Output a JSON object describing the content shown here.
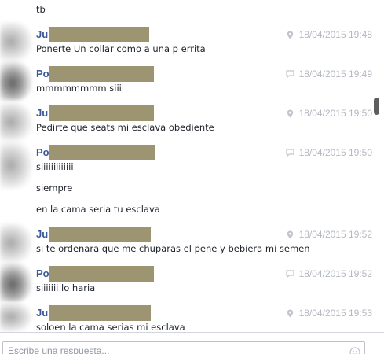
{
  "colors": {
    "sender": "#3b5998",
    "timestamp": "#b4b8c0",
    "text": "#1d2129",
    "redaction": "#9d9472"
  },
  "messages": [
    {
      "lines": [
        "tb"
      ]
    },
    {
      "sender": "Ju",
      "icon": "location-pin-icon",
      "timestamp": "18/04/2015 19:48",
      "lines": [
        "Ponerte Un collar como a una p errita"
      ]
    },
    {
      "sender": "Po",
      "icon": "chat-bubble-icon",
      "timestamp": "18/04/2015 19:49",
      "lines": [
        "mmmmmmmm siiii"
      ]
    },
    {
      "sender": "Ju",
      "icon": "location-pin-icon",
      "timestamp": "18/04/2015 19:50",
      "lines": [
        "Pedirte que seats mi esclava obediente"
      ]
    },
    {
      "sender": "Po",
      "icon": "chat-bubble-icon",
      "timestamp": "18/04/2015 19:50",
      "lines": [
        "siiiiiiiiiiiii",
        "siempre",
        "en la cama seria tu esclava"
      ]
    },
    {
      "sender": "Ju",
      "icon": "location-pin-icon",
      "timestamp": "18/04/2015 19:52",
      "lines": [
        "si te ordenara que me chuparas el pene y bebiera mi semen"
      ]
    },
    {
      "sender": "Po",
      "icon": "chat-bubble-icon",
      "timestamp": "18/04/2015 19:52",
      "lines": [
        "siiiiiii lo haria"
      ]
    },
    {
      "sender": "Ju",
      "icon": "location-pin-icon",
      "timestamp": "18/04/2015 19:53",
      "lines": [
        "soloen la cama serias mi esclava"
      ]
    }
  ],
  "composer": {
    "placeholder": "Escribe una respuesta...",
    "emoji_icon": "emoji-smile-icon"
  }
}
